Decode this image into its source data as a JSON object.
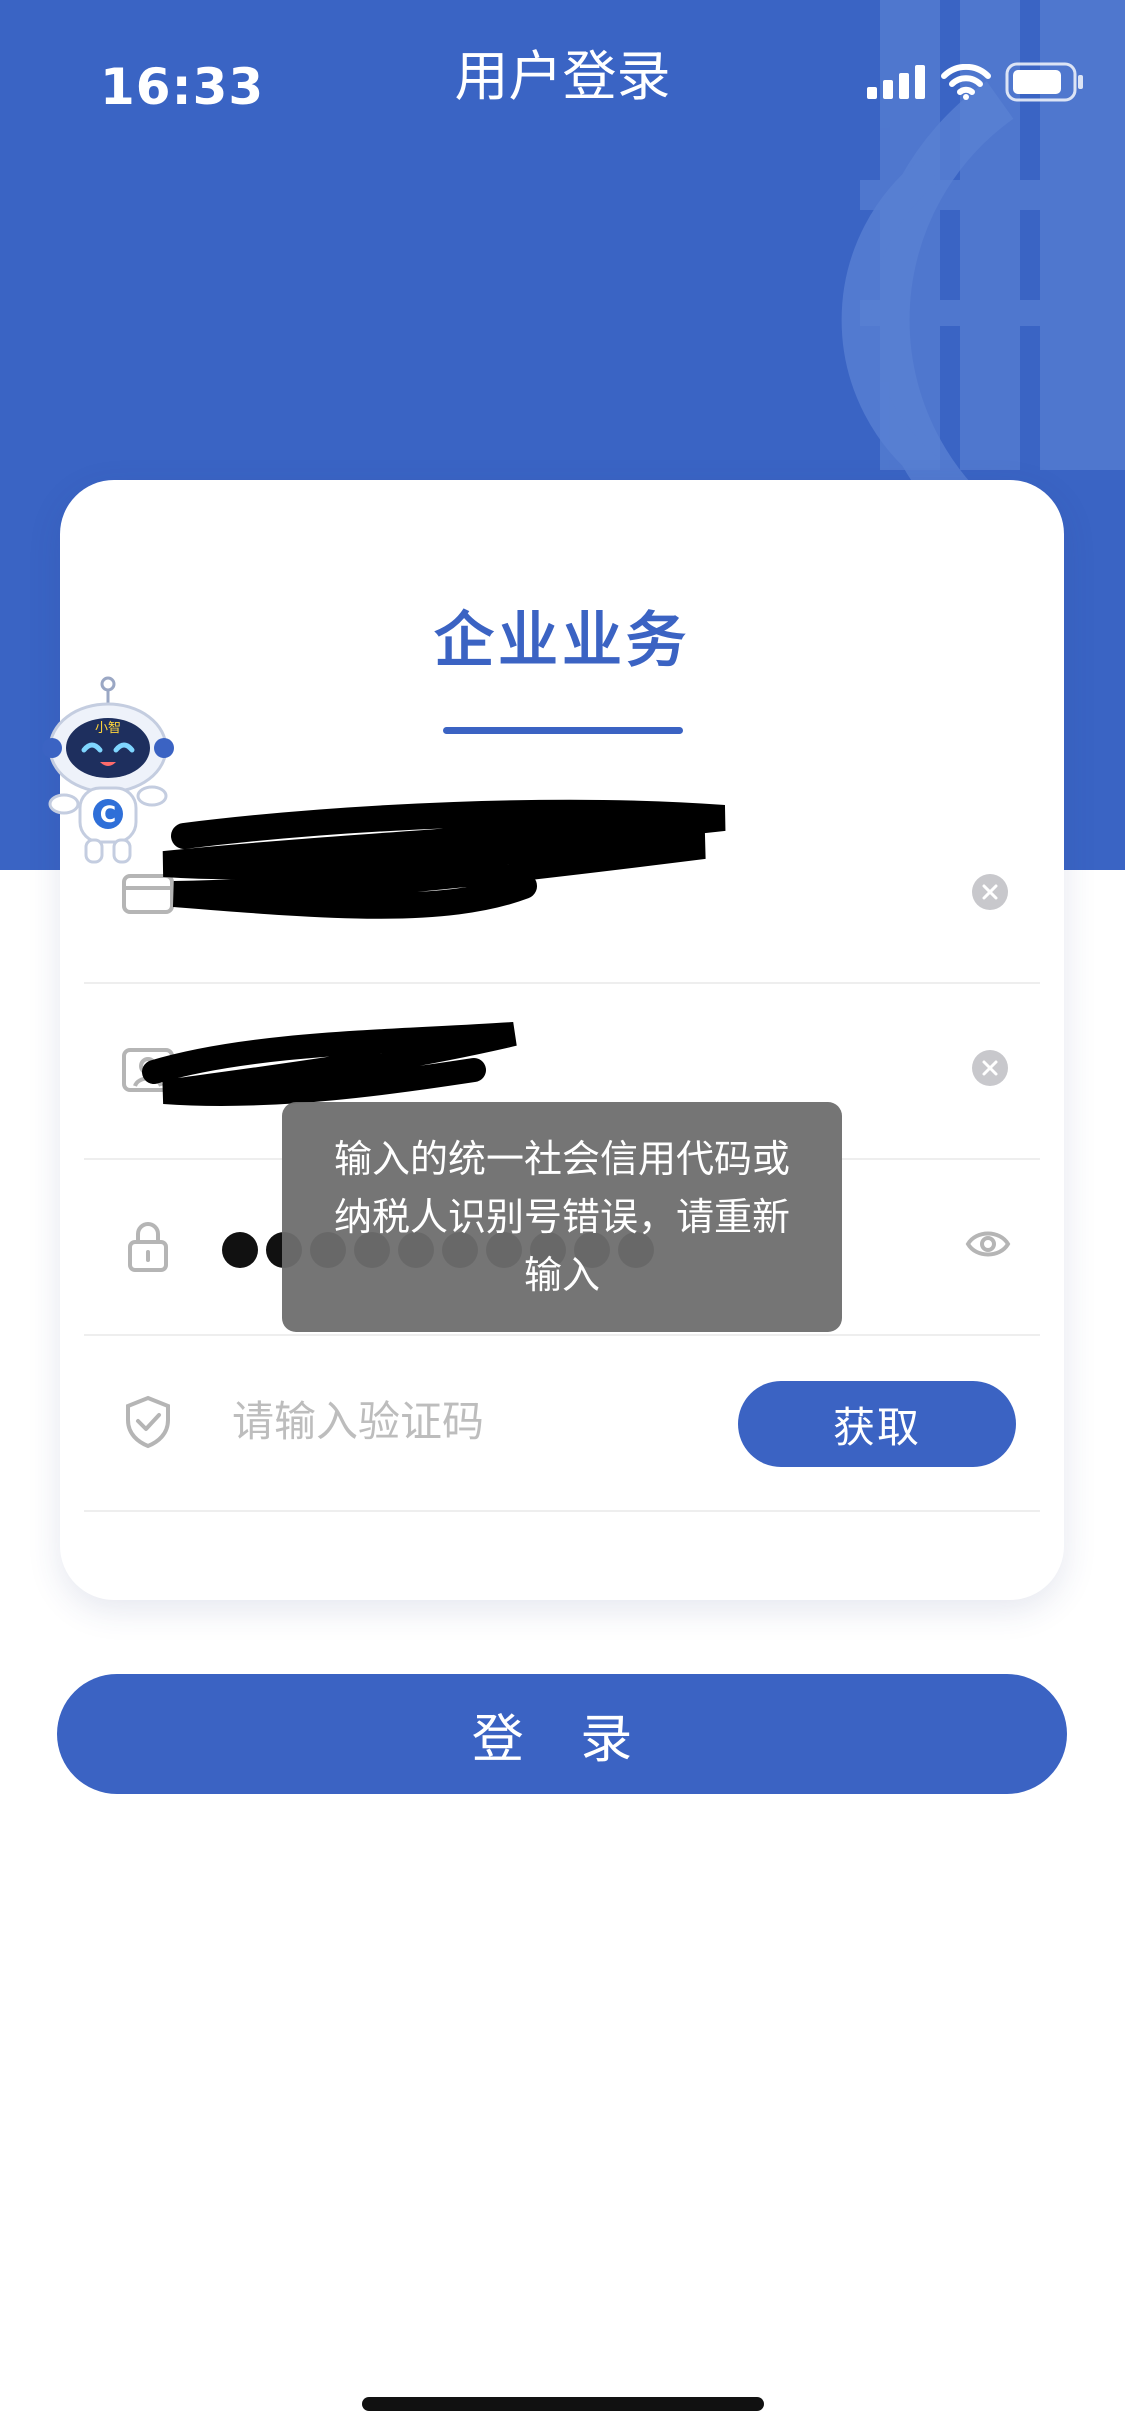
{
  "status_bar": {
    "time": "16:33"
  },
  "header": {
    "title": "用户登录"
  },
  "card": {
    "title": "企业业务"
  },
  "fields": {
    "credit_code": {
      "value": ""
    },
    "username": {
      "value": ""
    },
    "password": {
      "masked_dots": 10
    },
    "verify_code": {
      "placeholder": "请输入验证码",
      "value": "",
      "button_label": "获取"
    }
  },
  "login_button": {
    "label": "登 录"
  },
  "toast": {
    "message": "输入的统一社会信用代码或纳税人识别号错误，请重新输入"
  },
  "mascot": {
    "badge_text": "小智"
  },
  "colors": {
    "primary": "#3b63c3",
    "hero": "#3a64c4",
    "toast": "#6e6e6e"
  },
  "icons": [
    "card-icon",
    "user-card-icon",
    "lock-icon",
    "shield-check-icon",
    "clear-icon",
    "eye-icon",
    "signal-icon",
    "wifi-icon",
    "battery-icon"
  ]
}
